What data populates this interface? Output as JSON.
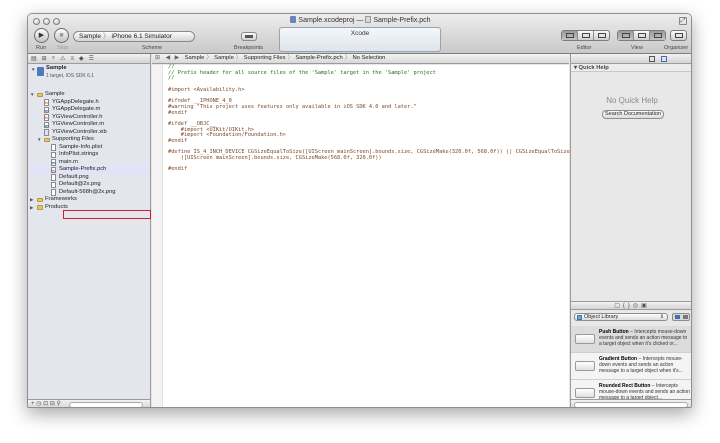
{
  "window": {
    "title_project": "Sample.xcodeproj",
    "title_separator": "—",
    "title_file": "Sample-Prefix.pch"
  },
  "toolbar": {
    "run_label": "Run",
    "stop_label": "Stop",
    "scheme_target": "Sample",
    "scheme_destination": "iPhone 6.1 Simulator",
    "scheme_label": "Scheme",
    "breakpoints_label": "Breakpoints",
    "activity_text": "Xcode",
    "editor_label": "Editor",
    "view_label": "View",
    "organizer_label": "Organizer"
  },
  "navigator": {
    "project": {
      "name": "Sample",
      "subtitle": "1 target, iOS SDK 6.1"
    },
    "items": [
      {
        "label": "Sample",
        "kind": "folder",
        "level": 1,
        "expanded": true
      },
      {
        "label": "YGAppDelegate.h",
        "kind": "h",
        "level": 2
      },
      {
        "label": "YGAppDelegate.m",
        "kind": "m",
        "level": 2
      },
      {
        "label": "YGViewController.h",
        "kind": "h",
        "level": 2
      },
      {
        "label": "YGViewController.m",
        "kind": "m",
        "level": 2
      },
      {
        "label": "YGViewController.xib",
        "kind": "xib",
        "level": 2
      },
      {
        "label": "Supporting Files",
        "kind": "folder",
        "level": 2,
        "expanded": true
      },
      {
        "label": "Sample-Info.plist",
        "kind": "file",
        "level": 3
      },
      {
        "label": "InfoPlist.strings",
        "kind": "file",
        "level": 3
      },
      {
        "label": "main.m",
        "kind": "m",
        "level": 3
      },
      {
        "label": "Sample-Prefix.pch",
        "kind": "h",
        "level": 3,
        "selected": true
      },
      {
        "label": "Default.png",
        "kind": "file",
        "level": 3
      },
      {
        "label": "Default@2x.png",
        "kind": "file",
        "level": 3
      },
      {
        "label": "Default-568h@2x.png",
        "kind": "file",
        "level": 3
      },
      {
        "label": "Frameworks",
        "kind": "folder",
        "level": 1,
        "expanded": false
      },
      {
        "label": "Products",
        "kind": "folder",
        "level": 1,
        "expanded": false
      }
    ]
  },
  "jumpbar": {
    "crumbs": [
      "Sample",
      "Sample",
      "Supporting Files",
      "Sample-Prefix.pch",
      "No Selection"
    ]
  },
  "editor": {
    "lines": [
      {
        "t": "//",
        "k": "comment"
      },
      {
        "t": "// Prefix header for all source files of the 'Sample' target in the 'Sample' project",
        "k": "comment"
      },
      {
        "t": "//",
        "k": "comment"
      },
      {
        "t": "",
        "k": "plain"
      },
      {
        "t": "#import <Availability.h>",
        "k": "pre"
      },
      {
        "t": "",
        "k": "plain"
      },
      {
        "t": "#ifndef __IPHONE_4_0",
        "k": "pre"
      },
      {
        "t": "#warning \"This project uses features only available in iOS SDK 4.0 and later.\"",
        "k": "pre"
      },
      {
        "t": "#endif",
        "k": "pre"
      },
      {
        "t": "",
        "k": "plain"
      },
      {
        "t": "#ifdef __OBJC__",
        "k": "pre"
      },
      {
        "t": "    #import <UIKit/UIKit.h>",
        "k": "pre"
      },
      {
        "t": "    #import <Foundation/Foundation.h>",
        "k": "pre"
      },
      {
        "t": "#endif",
        "k": "pre"
      },
      {
        "t": "",
        "k": "plain"
      },
      {
        "t": "#define IS_4_INCH_DEVICE CGSizeEqualToSize([UIScreen mainScreen].bounds.size, CGSizeMake(320.0f, 568.0f)) || CGSizeEqualToSize",
        "k": "pre"
      },
      {
        "t": "    ([UIScreen mainScreen].bounds.size, CGSizeMake(568.0f, 320.0f))",
        "k": "pre"
      },
      {
        "t": "",
        "k": "plain"
      },
      {
        "t": "#endif",
        "k": "pre"
      }
    ]
  },
  "utilities": {
    "quick_help_header": "Quick Help",
    "no_quick_help": "No Quick Help",
    "search_docs_label": "Search Documentation",
    "library_select": "Object Library",
    "library_items": [
      {
        "name": "Push Button",
        "desc": " – Intercepts mouse-down events and sends an action message to a target object when it's clicked or..."
      },
      {
        "name": "Gradient Button",
        "desc": " – Intercepts mouse-down events and sends an action message to a target object when it's..."
      },
      {
        "name": "Rounded Rect Button",
        "desc": " – Intercepts mouse-down events and sends an action message to a target object..."
      }
    ]
  }
}
